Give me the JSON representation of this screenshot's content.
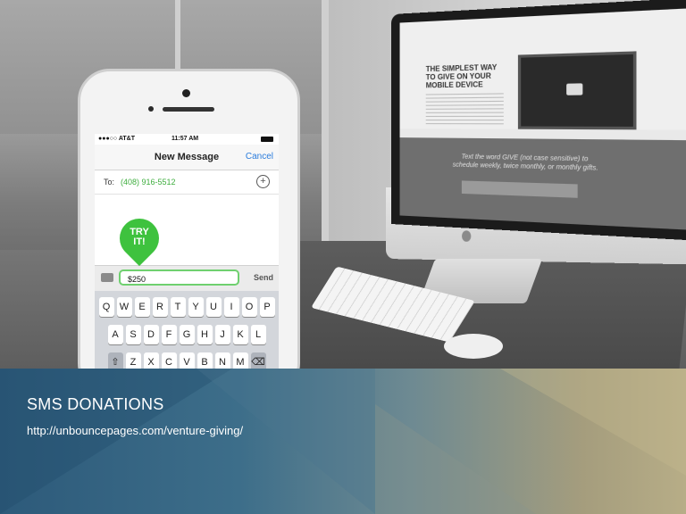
{
  "slide": {
    "title": "SMS DONATIONS",
    "url": "http://unbouncepages.com/venture-giving/"
  },
  "imac_landing_page": {
    "headline": "THE SIMPLEST WAY TO GIVE ON YOUR MOBILE DEVICE",
    "cta_text": "Text the word GIVE (not case sensitive) to schedule weekly, twice monthly, or monthly gifts."
  },
  "phone": {
    "status": {
      "carrier": "●●●○○ AT&T",
      "time": "11:57 AM"
    },
    "nav": {
      "title": "New Message",
      "cancel_label": "Cancel"
    },
    "to_label": "To:",
    "to_number": "(408) 916-5512",
    "message_value": "$250",
    "send_label": "Send",
    "try_label_1": "TRY",
    "try_label_2": "IT!",
    "keyboard": {
      "row1": [
        "Q",
        "W",
        "E",
        "R",
        "T",
        "Y",
        "U",
        "I",
        "O",
        "P"
      ],
      "row2": [
        "A",
        "S",
        "D",
        "F",
        "G",
        "H",
        "J",
        "K",
        "L"
      ],
      "row3": [
        "Z",
        "X",
        "C",
        "V",
        "B",
        "N",
        "M"
      ]
    }
  },
  "colors": {
    "accent_green": "#3ec23e",
    "ios_blue": "#2b7cdc"
  }
}
